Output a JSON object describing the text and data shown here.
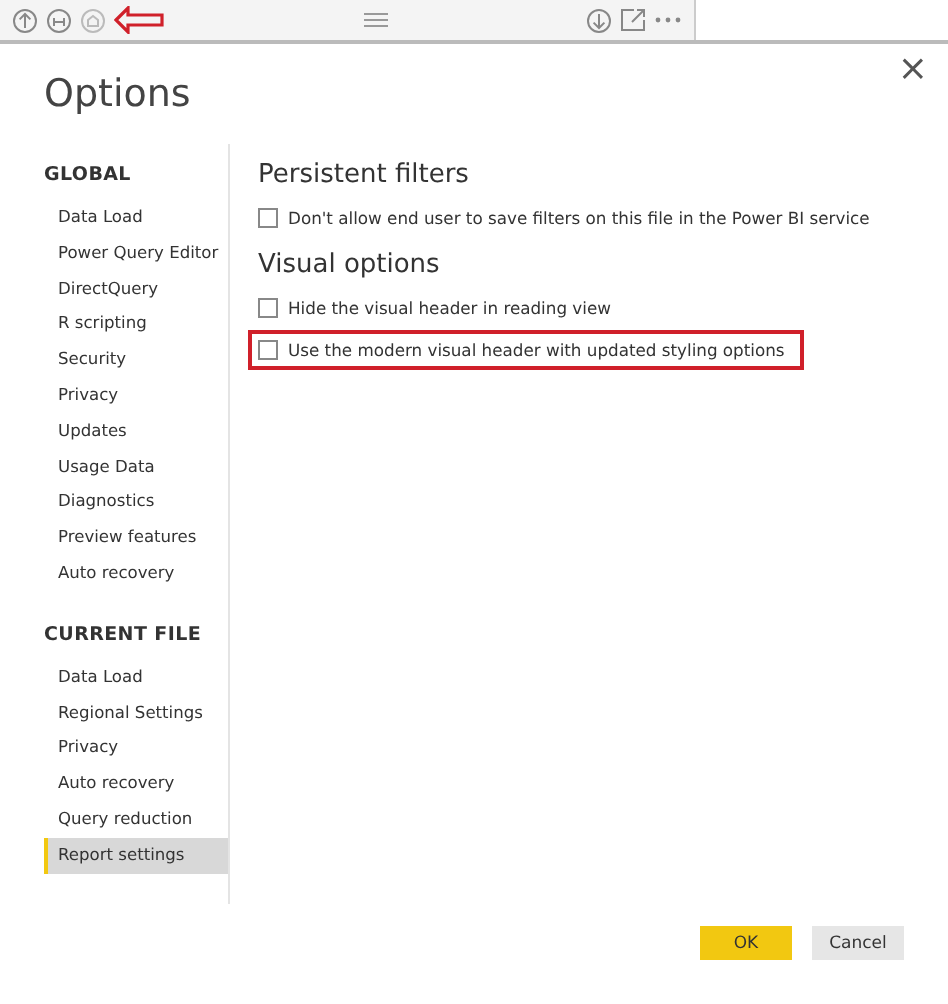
{
  "dialog": {
    "title": "Options",
    "close": "×"
  },
  "sidebar": {
    "sections": [
      {
        "heading": "GLOBAL",
        "items": [
          {
            "label": "Data Load",
            "selected": false
          },
          {
            "label": "Power Query Editor",
            "selected": false
          },
          {
            "label": "DirectQuery",
            "selected": false
          },
          {
            "label": "R scripting",
            "selected": false
          },
          {
            "label": "Security",
            "selected": false
          },
          {
            "label": "Privacy",
            "selected": false
          },
          {
            "label": "Updates",
            "selected": false
          },
          {
            "label": "Usage Data",
            "selected": false
          },
          {
            "label": "Diagnostics",
            "selected": false
          },
          {
            "label": "Preview features",
            "selected": false
          },
          {
            "label": "Auto recovery",
            "selected": false
          }
        ]
      },
      {
        "heading": "CURRENT FILE",
        "items": [
          {
            "label": "Data Load",
            "selected": false
          },
          {
            "label": "Regional Settings",
            "selected": false
          },
          {
            "label": "Privacy",
            "selected": false
          },
          {
            "label": "Auto recovery",
            "selected": false
          },
          {
            "label": "Query reduction",
            "selected": false
          },
          {
            "label": "Report settings",
            "selected": true
          }
        ]
      }
    ]
  },
  "content": {
    "groups": [
      {
        "heading": "Persistent filters",
        "options": [
          {
            "label": "Don't allow end user to save filters on this file in the Power BI service",
            "checked": false,
            "highlighted": false
          }
        ]
      },
      {
        "heading": "Visual options",
        "options": [
          {
            "label": "Hide the visual header in reading view",
            "checked": false,
            "highlighted": false
          },
          {
            "label": "Use the modern visual header with updated styling options",
            "checked": false,
            "highlighted": true
          }
        ]
      }
    ]
  },
  "buttons": [
    {
      "label": "OK",
      "kind": "primary"
    },
    {
      "label": "Cancel",
      "kind": "secondary"
    }
  ]
}
